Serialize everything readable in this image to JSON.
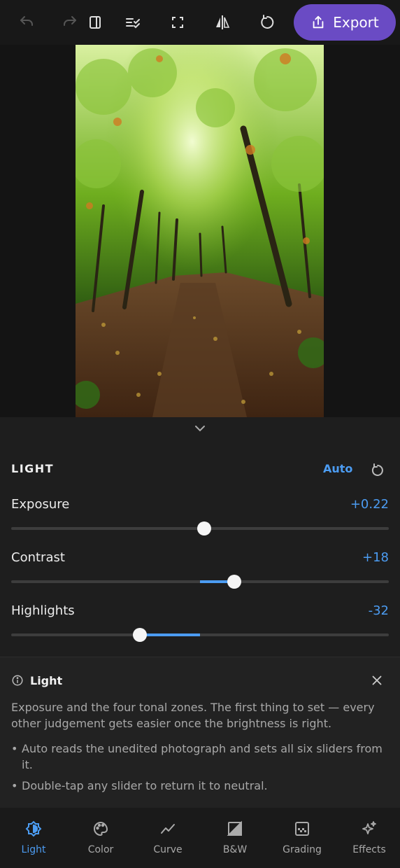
{
  "toolbar": {
    "icons": [
      "undo-icon",
      "redo-icon",
      "sidebar-icon",
      "checklist-icon",
      "fullscreen-icon",
      "compare-icon",
      "reset-icon",
      "share-icon"
    ],
    "export_label": "Export"
  },
  "panel": {
    "section_title": "LIGHT",
    "auto_label": "Auto",
    "sliders": [
      {
        "label": "Exposure",
        "value": "+0.22",
        "level": 0.022
      },
      {
        "label": "Contrast",
        "value": "+18",
        "level": 0.18
      },
      {
        "label": "Highlights",
        "value": "-32",
        "level": -0.32
      }
    ]
  },
  "info": {
    "title": "Light",
    "text": "Exposure and the four tonal zones. The first thing to set — every other judgement gets easier once the brightness is right.",
    "bullets": [
      "Auto reads the unedited photograph and sets all six sliders from it.",
      "Double-tap any slider to return it to neutral."
    ]
  },
  "nav": {
    "tabs": [
      {
        "label": "Light",
        "active": true
      },
      {
        "label": "Color",
        "active": false
      },
      {
        "label": "Curve",
        "active": false
      },
      {
        "label": "B&W",
        "active": false
      },
      {
        "label": "Grading",
        "active": false
      },
      {
        "label": "Effects",
        "active": false
      }
    ]
  },
  "colors": {
    "accent": "#4c9cf2",
    "export": "#6a4bc4"
  }
}
